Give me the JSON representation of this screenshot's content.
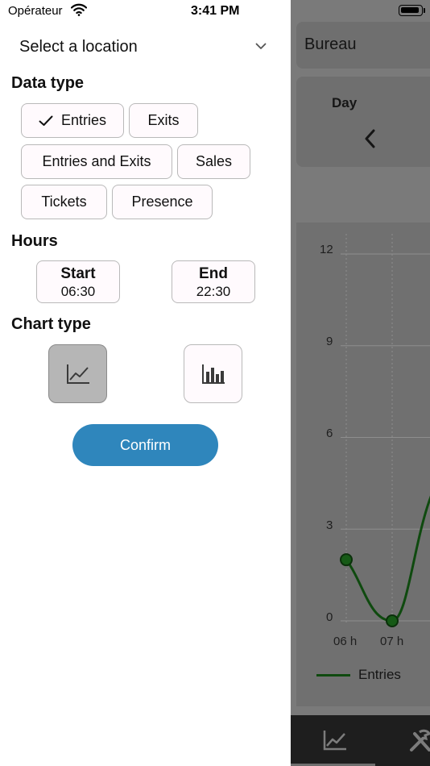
{
  "status_bar": {
    "carrier": "Opérateur",
    "time": "3:41 PM"
  },
  "panel": {
    "location": {
      "placeholder": "Select a location"
    },
    "data_type": {
      "title": "Data type",
      "options": [
        {
          "label": "Entries",
          "selected": true
        },
        {
          "label": "Exits",
          "selected": false
        },
        {
          "label": "Entries and Exits",
          "selected": false
        },
        {
          "label": "Sales",
          "selected": false
        },
        {
          "label": "Tickets",
          "selected": false
        },
        {
          "label": "Presence",
          "selected": false
        }
      ]
    },
    "hours": {
      "title": "Hours",
      "start": {
        "label": "Start",
        "value": "06:30"
      },
      "end": {
        "label": "End",
        "value": "22:30"
      }
    },
    "chart_type": {
      "title": "Chart type",
      "options": [
        {
          "icon": "line-chart-icon",
          "selected": true
        },
        {
          "icon": "bar-chart-icon",
          "selected": false
        }
      ]
    },
    "confirm_label": "Confirm"
  },
  "background": {
    "location_name": "Bureau",
    "period_label": "Day",
    "chart": {
      "y_ticks": [
        "12",
        "9",
        "6",
        "3",
        "0"
      ],
      "x_ticks": [
        "06 h",
        "07 h"
      ],
      "legend": "Entries"
    }
  },
  "chart_data": {
    "type": "line",
    "x": [
      "06 h",
      "07 h"
    ],
    "series": [
      {
        "name": "Entries",
        "values": [
          2,
          0
        ]
      }
    ],
    "ylim": [
      0,
      12
    ],
    "y_ticks": [
      0,
      3,
      6,
      9,
      12
    ],
    "grid": true,
    "legend_position": "bottom-left"
  },
  "colors": {
    "accent": "#2f86bc",
    "series_line": "#0f4a0f",
    "overlay": "#7a7a7a"
  }
}
